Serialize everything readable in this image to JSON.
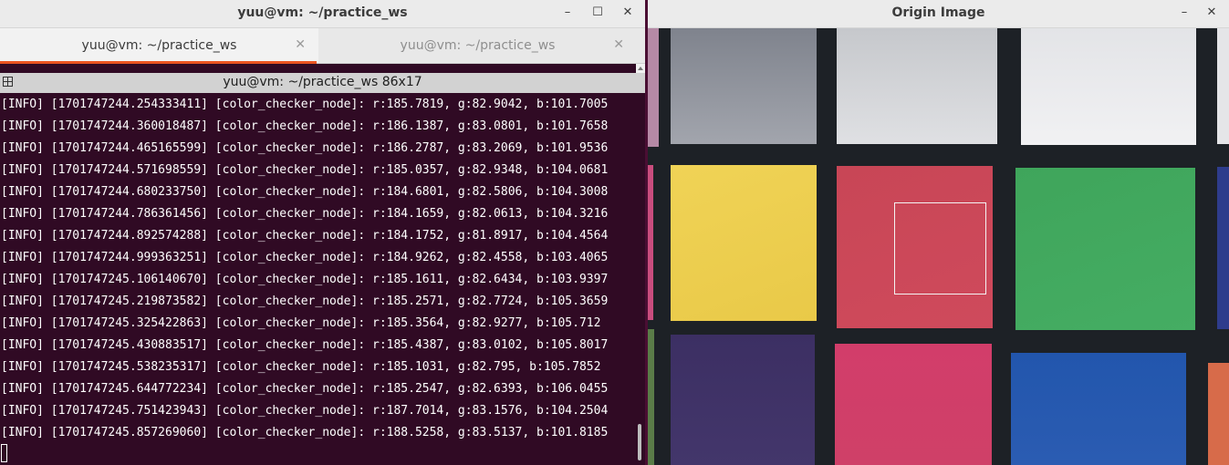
{
  "terminal": {
    "window_title": "yuu@vm: ~/practice_ws",
    "tabs": [
      {
        "label": "yuu@vm: ~/practice_ws",
        "active": true
      },
      {
        "label": "yuu@vm: ~/practice_ws",
        "active": false
      }
    ],
    "pane_title": "yuu@vm: ~/practice_ws 86x17",
    "lines": [
      "[INFO] [1701747244.254333411] [color_checker_node]: r:185.7819, g:82.9042, b:101.7005",
      "[INFO] [1701747244.360018487] [color_checker_node]: r:186.1387, g:83.0801, b:101.7658",
      "[INFO] [1701747244.465165599] [color_checker_node]: r:186.2787, g:83.2069, b:101.9536",
      "[INFO] [1701747244.571698559] [color_checker_node]: r:185.0357, g:82.9348, b:104.0681",
      "[INFO] [1701747244.680233750] [color_checker_node]: r:184.6801, g:82.5806, b:104.3008",
      "[INFO] [1701747244.786361456] [color_checker_node]: r:184.1659, g:82.0613, b:104.3216",
      "[INFO] [1701747244.892574288] [color_checker_node]: r:184.1752, g:81.8917, b:104.4564",
      "[INFO] [1701747244.999363251] [color_checker_node]: r:184.9262, g:82.4558, b:103.4065",
      "[INFO] [1701747245.106140670] [color_checker_node]: r:185.1611, g:82.6434, b:103.9397",
      "[INFO] [1701747245.219873582] [color_checker_node]: r:185.2571, g:82.7724, b:105.3659",
      "[INFO] [1701747245.325422863] [color_checker_node]: r:185.3564, g:82.9277, b:105.712",
      "[INFO] [1701747245.430883517] [color_checker_node]: r:185.4387, g:83.0102, b:105.8017",
      "[INFO] [1701747245.538235317] [color_checker_node]: r:185.1031, g:82.795, b:105.7852",
      "[INFO] [1701747245.644772234] [color_checker_node]: r:185.2547, g:82.6393, b:106.0455",
      "[INFO] [1701747245.751423943] [color_checker_node]: r:187.7014, g:83.1576, b:104.2504",
      "[INFO] [1701747245.857269060] [color_checker_node]: r:188.5258, g:83.5137, b:101.8185"
    ],
    "icons": {
      "minimize": "minimize-icon",
      "maximize": "maximize-icon",
      "close": "close-icon",
      "tab_close": "close-icon",
      "pane": "split-pane-icon"
    },
    "colors": {
      "background": "#300a24",
      "text": "#ffffff",
      "tab_indicator": "#e95420"
    }
  },
  "image_window": {
    "title": "Origin Image",
    "icons": {
      "minimize": "minimize-icon",
      "close": "close-icon"
    },
    "patch_colors": {
      "gray_left": "#8c8f98",
      "light_gray": "#d4d6d9",
      "white": "#ececef",
      "yellow": "#efce4f",
      "red": "#cc4958",
      "green": "#41a85e",
      "purple": "#3d2f63",
      "magenta": "#d03e68",
      "blue": "#2759b0",
      "orange": "#d76b4a",
      "frame": "#1d2126"
    }
  }
}
